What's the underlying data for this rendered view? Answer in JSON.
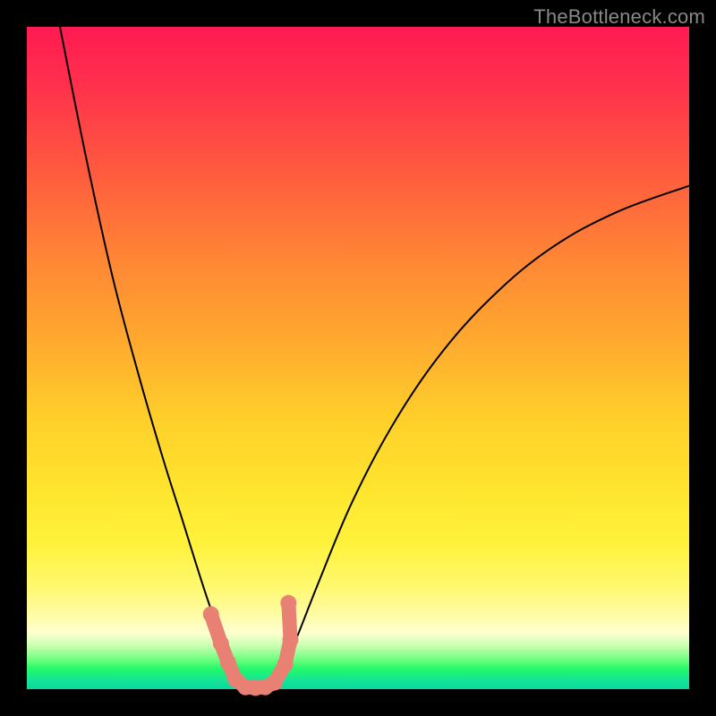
{
  "watermark": "TheBottleneck.com",
  "chart_data": {
    "type": "line",
    "title": "",
    "xlabel": "",
    "ylabel": "",
    "xlim": [
      0,
      1
    ],
    "ylim": [
      0,
      1
    ],
    "background_gradient_stops": [
      {
        "pos": 0.0,
        "color": "#ff1a52"
      },
      {
        "pos": 0.35,
        "color": "#ff8635"
      },
      {
        "pos": 0.7,
        "color": "#ffe52e"
      },
      {
        "pos": 0.9,
        "color": "#ffffd0"
      },
      {
        "pos": 0.96,
        "color": "#2cf26c"
      },
      {
        "pos": 1.0,
        "color": "#07db9d"
      }
    ],
    "series": [
      {
        "name": "left-branch",
        "x": [
          0.05,
          0.09,
          0.13,
          0.17,
          0.205,
          0.235,
          0.26,
          0.28,
          0.3,
          0.316,
          0.33
        ],
        "y": [
          1.0,
          0.8,
          0.62,
          0.47,
          0.35,
          0.255,
          0.175,
          0.115,
          0.065,
          0.03,
          0.003
        ]
      },
      {
        "name": "right-branch",
        "x": [
          0.37,
          0.4,
          0.44,
          0.49,
          0.55,
          0.62,
          0.7,
          0.79,
          0.89,
          1.0
        ],
        "y": [
          0.003,
          0.06,
          0.16,
          0.28,
          0.395,
          0.5,
          0.59,
          0.665,
          0.72,
          0.76
        ]
      }
    ],
    "points": {
      "name": "markers",
      "x": [
        0.278,
        0.293,
        0.304,
        0.315,
        0.33,
        0.345,
        0.36,
        0.374,
        0.39,
        0.398,
        0.395
      ],
      "y": [
        0.113,
        0.069,
        0.04,
        0.015,
        0.003,
        0.002,
        0.003,
        0.01,
        0.038,
        0.075,
        0.13
      ]
    }
  }
}
